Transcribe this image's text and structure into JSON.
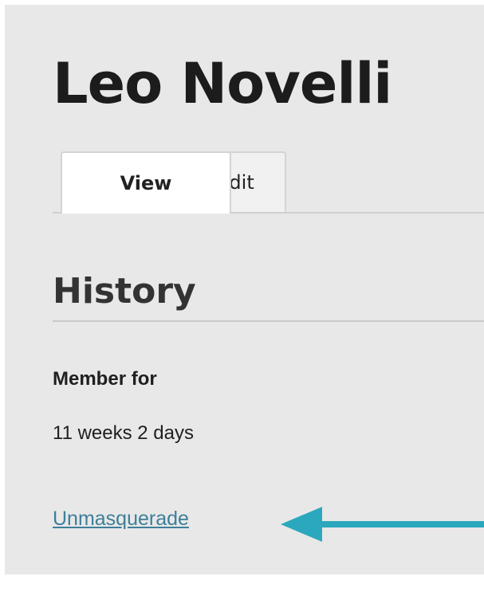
{
  "user": {
    "name": "Leo Novelli"
  },
  "tabs": [
    {
      "label": "View",
      "active": true
    },
    {
      "label": "Edit",
      "active": false
    }
  ],
  "history": {
    "title": "History",
    "member_for_label": "Member for",
    "member_for_value": "11 weeks 2 days"
  },
  "actions": {
    "unmasquerade_label": "Unmasquerade"
  },
  "annotation": {
    "arrow_color": "#2ba8bd",
    "icon": "left-arrow-icon"
  },
  "colors": {
    "page_background": "#e8e8e8",
    "link": "#3d7f9a"
  }
}
